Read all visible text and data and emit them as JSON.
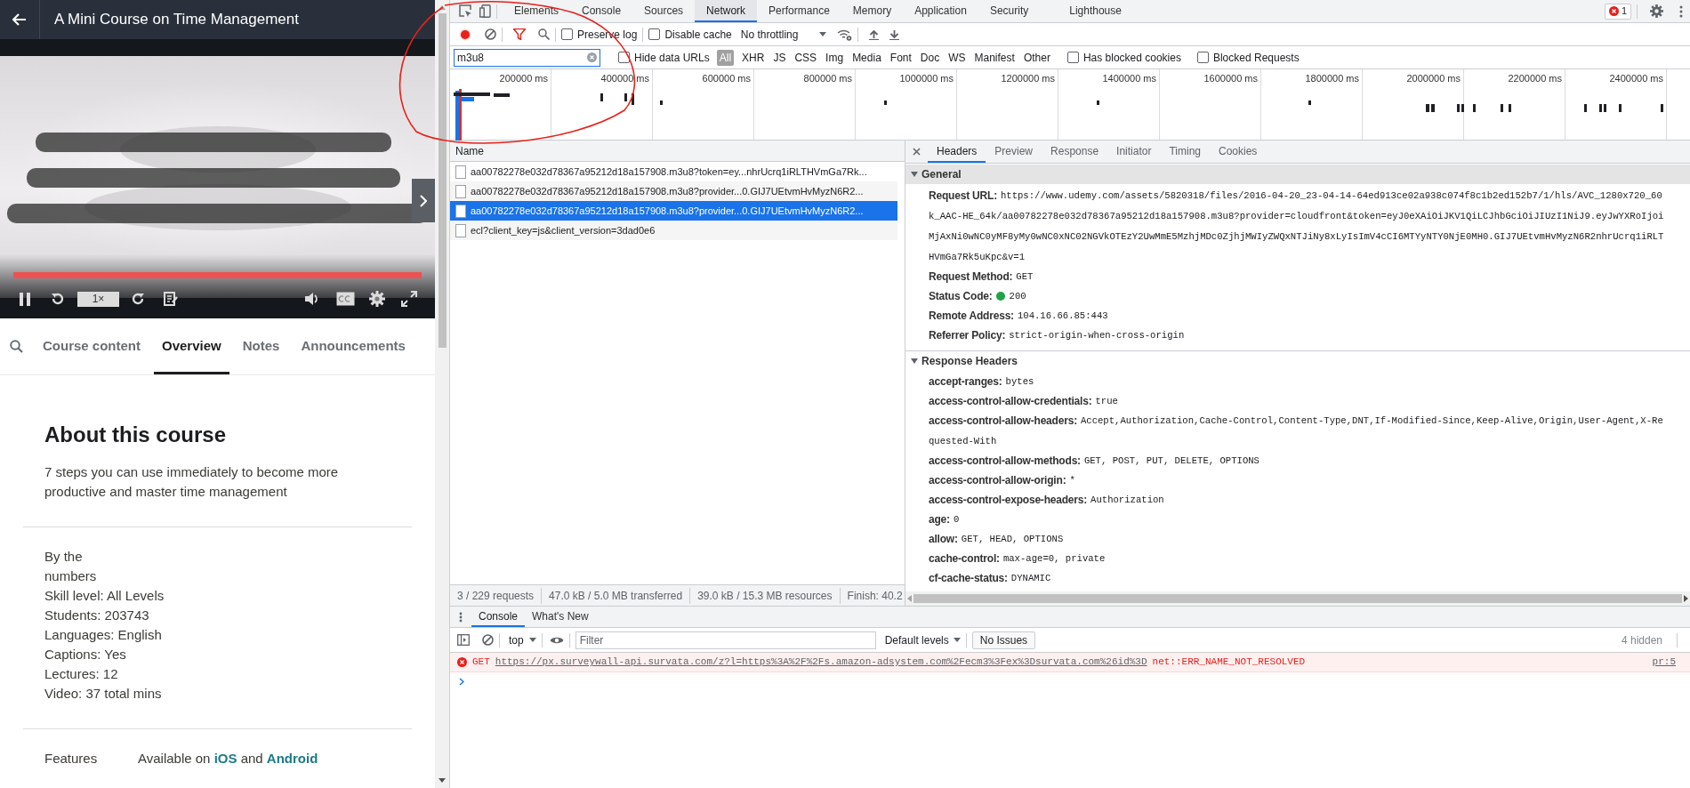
{
  "course_player": {
    "title": "A Mini Course on Time Management",
    "video": {
      "kind": "picture",
      "progress": {
        "level": 1
      }
    },
    "speed": "1×",
    "tabs": [
      {
        "label": "Course content",
        "selected": false
      },
      {
        "label": "Overview",
        "selected": true
      },
      {
        "label": "Notes",
        "selected": false
      },
      {
        "label": "Announcements",
        "selected": false
      }
    ],
    "about": {
      "heading": "About this course",
      "description": "7 steps you can use immediately to become more productive and master time management",
      "stats_label": "By the numbers",
      "stats": [
        "Skill level: All Levels",
        "Students: 203743",
        "Languages: English",
        "Captions: Yes",
        "Lectures: 12",
        "Video: 37 total mins"
      ],
      "features": {
        "label": "Features",
        "text_before": "Available on",
        "links": [
          "iOS",
          "Android"
        ],
        "joiner": "and"
      }
    }
  },
  "devtools": {
    "panel_tabs": [
      {
        "label": "Elements",
        "selected": false
      },
      {
        "label": "Console",
        "selected": false
      },
      {
        "label": "Sources",
        "selected": false
      },
      {
        "label": "Network",
        "selected": true
      },
      {
        "label": "Performance",
        "selected": false
      },
      {
        "label": "Memory",
        "selected": false
      },
      {
        "label": "Application",
        "selected": false
      },
      {
        "label": "Security",
        "selected": false
      },
      {
        "label": "Lighthouse",
        "selected": false
      }
    ],
    "error_count": "1",
    "network": {
      "recording": true,
      "preserve_log": {
        "label": "Preserve log",
        "checked": false
      },
      "disable_cache": {
        "label": "Disable cache",
        "checked": false
      },
      "throttling": "No throttling",
      "filter": "m3u8",
      "hide_data_urls": {
        "label": "Hide data URLs",
        "checked": false
      },
      "types": [
        {
          "label": "All",
          "selected": true
        },
        {
          "label": "XHR",
          "selected": false
        },
        {
          "label": "JS",
          "selected": false
        },
        {
          "label": "CSS",
          "selected": false
        },
        {
          "label": "Img",
          "selected": false
        },
        {
          "label": "Media",
          "selected": false
        },
        {
          "label": "Font",
          "selected": false
        },
        {
          "label": "Doc",
          "selected": false
        },
        {
          "label": "WS",
          "selected": false
        },
        {
          "label": "Manifest",
          "selected": false
        },
        {
          "label": "Other",
          "selected": false
        }
      ],
      "has_blocked_cookies": {
        "label": "Has blocked cookies",
        "checked": false
      },
      "blocked_requests": {
        "label": "Blocked Requests",
        "checked": false
      },
      "timeline_ticks": [
        "200000 ms",
        "400000 ms",
        "600000 ms",
        "800000 ms",
        "1000000 ms",
        "1200000 ms",
        "1400000 ms",
        "1600000 ms",
        "1800000 ms",
        "2000000 ms",
        "2200000 ms",
        "2400000 ms"
      ],
      "column": "Name",
      "requests": [
        {
          "name": "aa00782278e032d78367a95212d18a157908.m3u8?token=ey...nhrUcrq1iRLTHVmGa7Rk...",
          "selected": false
        },
        {
          "name": "aa00782278e032d78367a95212d18a157908.m3u8?provider...0.GIJ7UEtvmHvMyzN6R2...",
          "selected": false
        },
        {
          "name": "aa00782278e032d78367a95212d18a157908.m3u8?provider...0.GIJ7UEtvmHvMyzN6R2...",
          "selected": true
        },
        {
          "name": "ecl?client_key=js&client_version=3dad0e6",
          "selected": false
        }
      ],
      "summary": [
        "3 / 229 requests",
        "47.0 kB / 5.0 MB transferred",
        "39.0 kB / 15.3 MB resources",
        "Finish: 40.2"
      ]
    },
    "details": {
      "tabs": [
        {
          "label": "Headers",
          "selected": true
        },
        {
          "label": "Preview",
          "selected": false
        },
        {
          "label": "Response",
          "selected": false
        },
        {
          "label": "Initiator",
          "selected": false
        },
        {
          "label": "Timing",
          "selected": false
        },
        {
          "label": "Cookies",
          "selected": false
        }
      ],
      "sections": [
        {
          "title": "General",
          "expanded": true,
          "highlighted": true,
          "rows": [
            {
              "name": "Request URL:",
              "value_lines": [
                "https://www.udemy.com/assets/5820318/files/2016-04-20_23-04-14-64ed913ce02a938c074f8c1b2ed152b7/1/hls/AVC_1280x720_60",
                "k_AAC-HE_64k/aa00782278e032d78367a95212d18a157908.m3u8?provider=cloudfront&token=eyJ0eXAiOiJKV1QiLCJhbGciOiJIUzI1NiJ9.eyJwYXRoIjoi",
                "MjAxNi0wNC0yMF8yMy0wNC0xNC02NGVkOTEzY2UwMmE5MzhjMDc0ZjhjMWIyZWQxNTJiNy8xLyIsImV4cCI6MTYyNTY0NjE0MH0.GIJ7UEtvmHvMyzN6R2nhrUcrq1iRLT",
                "HVmGa7Rk5uKpc&v=1"
              ]
            },
            {
              "name": "Request Method:",
              "value_lines": [
                "GET"
              ]
            },
            {
              "name": "Status Code:",
              "value_lines": [
                "200"
              ],
              "ok": true
            },
            {
              "name": "Remote Address:",
              "value_lines": [
                "104.16.66.85:443"
              ]
            },
            {
              "name": "Referrer Policy:",
              "value_lines": [
                "strict-origin-when-cross-origin"
              ]
            }
          ]
        },
        {
          "title": "Response Headers",
          "expanded": true,
          "highlighted": false,
          "rows": [
            {
              "name": "accept-ranges:",
              "value_lines": [
                "bytes"
              ]
            },
            {
              "name": "access-control-allow-credentials:",
              "value_lines": [
                "true"
              ]
            },
            {
              "name": "access-control-allow-headers:",
              "value_lines": [
                "Accept,Authorization,Cache-Control,Content-Type,DNT,If-Modified-Since,Keep-Alive,Origin,User-Agent,X-Re",
                "quested-With"
              ]
            },
            {
              "name": "access-control-allow-methods:",
              "value_lines": [
                "GET, POST, PUT, DELETE, OPTIONS"
              ]
            },
            {
              "name": "access-control-allow-origin:",
              "value_lines": [
                "*"
              ]
            },
            {
              "name": "access-control-expose-headers:",
              "value_lines": [
                "Authorization"
              ]
            },
            {
              "name": "age:",
              "value_lines": [
                "0"
              ]
            },
            {
              "name": "allow:",
              "value_lines": [
                "GET, HEAD, OPTIONS"
              ]
            },
            {
              "name": "cache-control:",
              "value_lines": [
                "max-age=0, private"
              ]
            },
            {
              "name": "cf-cache-status:",
              "value_lines": [
                "DYNAMIC"
              ]
            }
          ]
        }
      ]
    },
    "console": {
      "tabs": [
        {
          "label": "Console",
          "selected": true
        },
        {
          "label": "What's New",
          "selected": false
        }
      ],
      "context": "top",
      "filter_placeholder": "Filter",
      "levels": "Default levels",
      "issues": "No Issues",
      "hidden": "4 hidden",
      "messages": [
        {
          "kind": "error",
          "method": "GET",
          "url": "https://px.surveywall-api.survata.com/z?l=https%3A%2F%2Fs.amazon-adsystem.com%2Fecm3%3Fex%3Dsurvata.com%26id%3D",
          "error": "net::ERR_NAME_NOT_RESOLVED",
          "source": "pr:5"
        }
      ]
    }
  }
}
